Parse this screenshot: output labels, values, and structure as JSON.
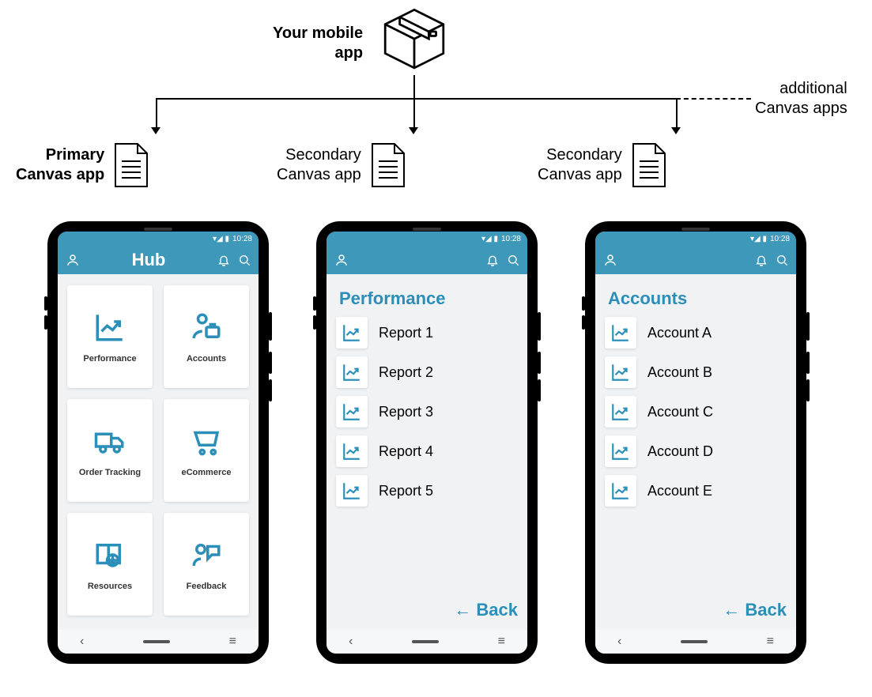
{
  "root": {
    "title": "Your mobile app",
    "additional_label": "additional Canvas apps"
  },
  "columns": [
    {
      "label": "Primary Canvas app",
      "primary": true
    },
    {
      "label": "Secondary Canvas app"
    },
    {
      "label": "Secondary Canvas app"
    }
  ],
  "status": {
    "time": "10:28"
  },
  "hub": {
    "title": "Hub",
    "tiles": [
      {
        "label": "Performance",
        "icon": "chart-up"
      },
      {
        "label": "Accounts",
        "icon": "user-briefcase"
      },
      {
        "label": "Order Tracking",
        "icon": "truck"
      },
      {
        "label": "eCommerce",
        "icon": "cart"
      },
      {
        "label": "Resources",
        "icon": "book-globe"
      },
      {
        "label": "Feedback",
        "icon": "user-chat"
      }
    ]
  },
  "performance": {
    "title": "Performance",
    "items": [
      "Report 1",
      "Report 2",
      "Report 3",
      "Report 4",
      "Report 5"
    ],
    "back": "← Back"
  },
  "accounts": {
    "title": "Accounts",
    "items": [
      "Account A",
      "Account B",
      "Account C",
      "Account D",
      "Account E"
    ],
    "back": "← Back"
  },
  "colors": {
    "accent": "#3e98b9",
    "accentText": "#2b8fb9"
  }
}
